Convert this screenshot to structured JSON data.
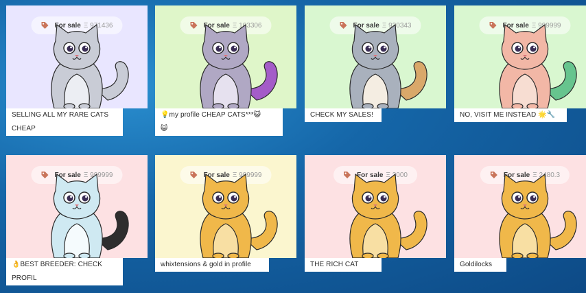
{
  "listings": [
    {
      "status": "For sale",
      "price": "Ξ 971436",
      "caption_lines": [
        "SELLING ALL MY RARE CATS",
        "CHEAP"
      ],
      "bg": "#e9e6ff",
      "body": "#c9ccd6",
      "belly": "#eceef3",
      "accent": "#c9ccd6"
    },
    {
      "status": "For sale",
      "price": "Ξ 103306",
      "caption_lines": [
        "💡my profile CHEAP CATS***😺",
        "😺"
      ],
      "bg": "#dff6c9",
      "body": "#b0a8c4",
      "belly": "#e6e1ef",
      "accent": "#a45cc8"
    },
    {
      "status": "For sale",
      "price": "Ξ 930343",
      "caption_lines": [
        "CHECK MY SALES!"
      ],
      "bg": "#d9f7d0",
      "body": "#a9b1bd",
      "belly": "#f4ede2",
      "accent": "#d9a86a"
    },
    {
      "status": "For sale",
      "price": "Ξ 999999",
      "caption_lines": [
        "NO, VISIT ME INSTEAD 🌟🔧"
      ],
      "bg": "#d9f7d0",
      "body": "#f2b7a6",
      "belly": "#f7ddd2",
      "accent": "#67c48e"
    },
    {
      "status": "For sale",
      "price": "Ξ 999999",
      "caption_lines": [
        "👌BEST BREEDER: CHECK",
        "PROFIL"
      ],
      "bg": "#fde1e3",
      "body": "#cfe9f2",
      "belly": "#f5fbfd",
      "accent": "#2e2e2e"
    },
    {
      "status": "For sale",
      "price": "Ξ 999999",
      "caption_lines": [
        "whixtensions & gold in profile"
      ],
      "bg": "#fbf6cf",
      "body": "#f0b84a",
      "belly": "#f8dfa3",
      "accent": "#f0b84a"
    },
    {
      "status": "For sale",
      "price": "Ξ 3000",
      "caption_lines": [
        "THE RICH CAT"
      ],
      "bg": "#fde1e3",
      "body": "#f0b84a",
      "belly": "#f8dfa3",
      "accent": "#f0b84a"
    },
    {
      "status": "For sale",
      "price": "Ξ 2480.3",
      "caption_lines": [
        "Goldilocks"
      ],
      "bg": "#fde1e3",
      "body": "#f0b84a",
      "belly": "#f8dfa3",
      "accent": "#f0b84a"
    }
  ],
  "icons": {
    "sale_tag": "price-tag-icon"
  }
}
